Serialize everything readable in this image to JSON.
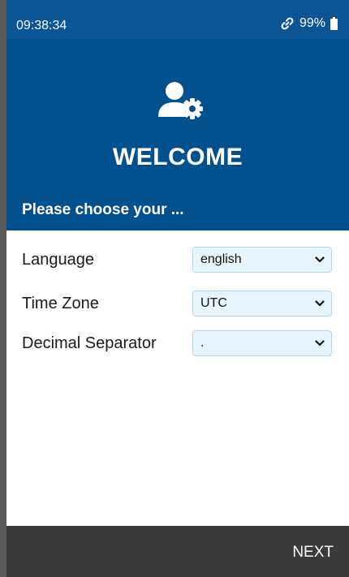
{
  "status_bar": {
    "time": "09:38:34",
    "battery_percent": "99%",
    "icons": [
      "link-icon",
      "battery-icon"
    ]
  },
  "header": {
    "icon": "user-gear-icon",
    "title": "WELCOME",
    "subtitle": "Please choose your ..."
  },
  "form": {
    "language": {
      "label": "Language",
      "value": "english"
    },
    "time_zone": {
      "label": "Time Zone",
      "value": "UTC"
    },
    "decimal_separator": {
      "label": "Decimal Separator",
      "value": "."
    }
  },
  "footer": {
    "next_label": "NEXT"
  },
  "colors": {
    "header_blue": "#02518e",
    "status_blue": "#0a5596",
    "footer_dark": "#3b3b3b",
    "select_bg": "#e7f4fb",
    "select_border": "#b4d7ea"
  }
}
